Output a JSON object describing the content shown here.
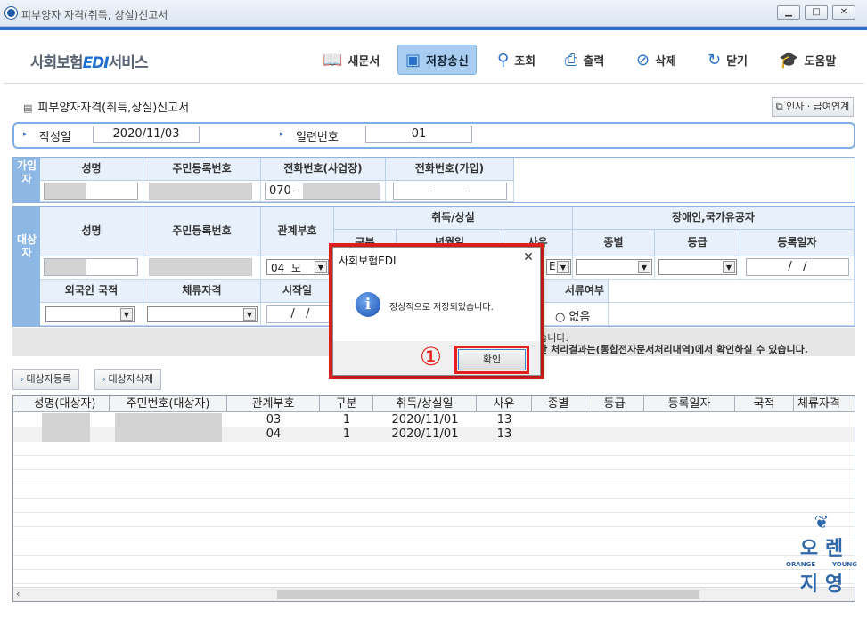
{
  "window": {
    "title": "피부양자 자격(취득, 상실)신고서"
  },
  "brand": {
    "prefix": "사회보험",
    "edi": "EDI",
    "suffix": "서비스"
  },
  "toolbar": {
    "new": "새문서",
    "save": "저장송신",
    "search": "조회",
    "print": "출력",
    "delete": "삭제",
    "close": "닫기",
    "help": "도움말"
  },
  "page": {
    "title": "피부양자자격(취득,상실)신고서",
    "hr_link": "인사 · 급여연계",
    "created_label": "작성일",
    "created_value": "2020/11/03",
    "serial_label": "일련번호",
    "serial_value": "01"
  },
  "subscriber": {
    "side": "가입자",
    "headers": [
      "성명",
      "주민등록번호",
      "전화번호(사업장)",
      "전화번호(가입)"
    ],
    "phone_work": "070 -",
    "phone_home": "–        –"
  },
  "target": {
    "side": "대상자",
    "headers": {
      "name": "성명",
      "rrn": "주민등록번호",
      "relation": "관계부호",
      "acq_loss": "취득/상실",
      "gubun": "구분",
      "date": "년월일",
      "reason": "사유",
      "disabled": "장애인,국가유공자",
      "kind": "종별",
      "grade": "등급",
      "reg_date": "등록일자",
      "foreign_nat": "외국인 국적",
      "stay": "체류자격",
      "start": "시작일",
      "doc": "서류여부"
    },
    "relation_value": "04  모",
    "reason_value": "E",
    "reg_date_value": "/   /",
    "start_value": "/   /",
    "doc_option": "없음"
  },
  "notice": {
    "line1": "있습니다.",
    "line2": "대한 처리결과는(통합전자문서처리내역)에서 확인하실 수 있습니다."
  },
  "buttons": {
    "add": "대상자등록",
    "remove": "대상자삭제"
  },
  "table": {
    "headers": [
      "성명(대상자)",
      "주민번호(대상자)",
      "관계부호",
      "구분",
      "취득/상실일",
      "사유",
      "종별",
      "등급",
      "등록일자",
      "국적",
      "체류자격"
    ],
    "rows": [
      {
        "relation": "03",
        "gubun": "1",
        "date": "2020/11/01",
        "reason": "13"
      },
      {
        "relation": "04",
        "gubun": "1",
        "date": "2020/11/01",
        "reason": "13"
      }
    ]
  },
  "dialog": {
    "title": "사회보험EDI",
    "message": "정상적으로 저장되었습니다.",
    "ok": "확인",
    "step_marker": "①"
  },
  "watermark": {
    "line1": "오 렌",
    "line2": "지 영",
    "left": "ORANGE",
    "right": "YOUNG"
  }
}
